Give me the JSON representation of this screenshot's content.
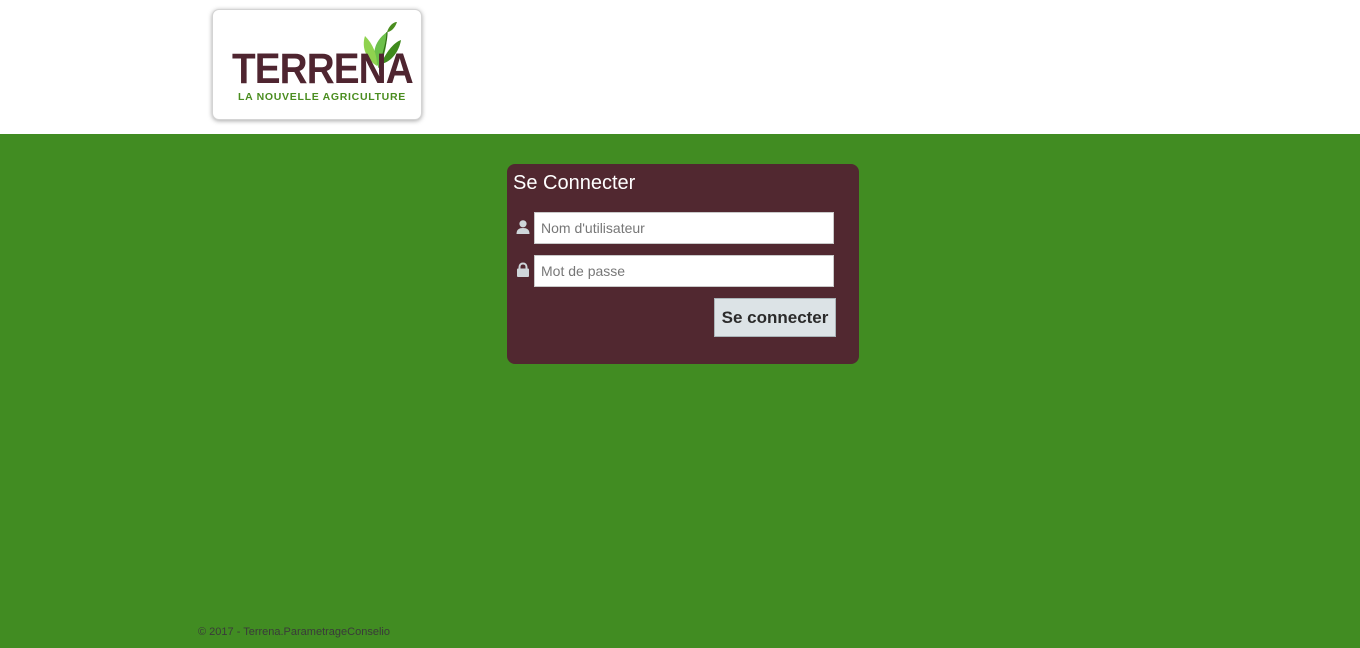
{
  "brand": {
    "logo_word": "TERRENA",
    "logo_tagline": "LA NOUVELLE AGRICULTURE",
    "colors": {
      "header_bg": "#ffffff",
      "page_bg": "#418c22",
      "panel_bg": "#512830",
      "logo_word": "#4f2530",
      "logo_green": "#4a8d1f"
    }
  },
  "login": {
    "title": "Se Connecter",
    "username": {
      "icon": "user-icon",
      "placeholder": "Nom d'utilisateur",
      "value": ""
    },
    "password": {
      "icon": "lock-icon",
      "placeholder": "Mot de passe",
      "value": ""
    },
    "submit_label": "Se connecter",
    "button_bg": "#dce3e6"
  },
  "footer": {
    "text": "© 2017 - Terrena.ParametrageConselio"
  }
}
